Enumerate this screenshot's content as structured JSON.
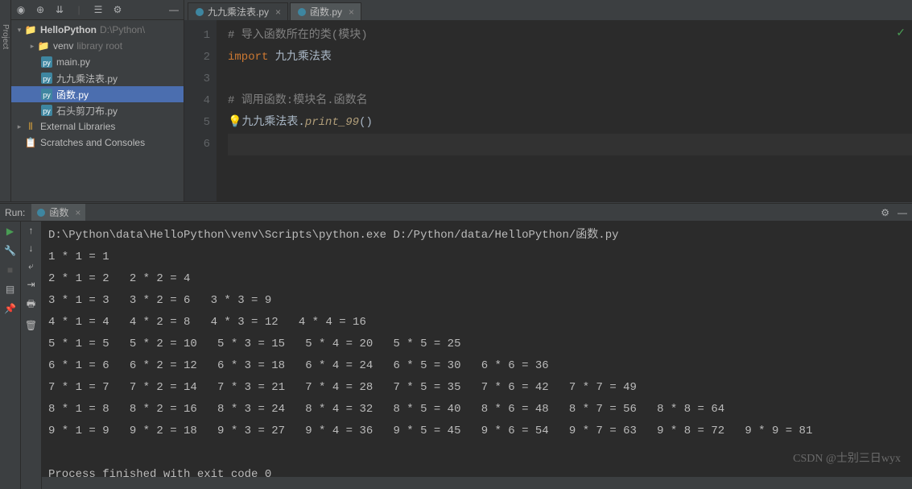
{
  "tabs": [
    {
      "label": "九九乘法表.py",
      "active": false
    },
    {
      "label": "函数.py",
      "active": true
    }
  ],
  "tree": {
    "project": "HelloPython",
    "project_path": "D:\\Python\\",
    "venv": "venv",
    "venv_tag": "library root",
    "files": [
      "main.py",
      "九九乘法表.py",
      "函数.py",
      "石头剪刀布.py"
    ],
    "selected": "函数.py",
    "ext_lib": "External Libraries",
    "scratches": "Scratches and Consoles"
  },
  "gutter": [
    "1",
    "2",
    "3",
    "4",
    "5",
    "6"
  ],
  "code": {
    "c1": "#  导入函数所在的类(模块)",
    "kw": "import",
    "imp": " 九九乘法表",
    "c2": "#  调用函数:模块名.函数名",
    "mod": "九九乘法表.",
    "fn": "print_99",
    "paren": "()"
  },
  "run": {
    "label": "Run:",
    "tab": "函数",
    "cmd": "D:\\Python\\data\\HelloPython\\venv\\Scripts\\python.exe D:/Python/data/HelloPython/函数.py",
    "lines": [
      "1 * 1 = 1",
      "2 * 1 = 2   2 * 2 = 4",
      "3 * 1 = 3   3 * 2 = 6   3 * 3 = 9",
      "4 * 1 = 4   4 * 2 = 8   4 * 3 = 12   4 * 4 = 16",
      "5 * 1 = 5   5 * 2 = 10   5 * 3 = 15   5 * 4 = 20   5 * 5 = 25",
      "6 * 1 = 6   6 * 2 = 12   6 * 3 = 18   6 * 4 = 24   6 * 5 = 30   6 * 6 = 36",
      "7 * 1 = 7   7 * 2 = 14   7 * 3 = 21   7 * 4 = 28   7 * 5 = 35   7 * 6 = 42   7 * 7 = 49",
      "8 * 1 = 8   8 * 2 = 16   8 * 3 = 24   8 * 4 = 32   8 * 5 = 40   8 * 6 = 48   8 * 7 = 56   8 * 8 = 64",
      "9 * 1 = 9   9 * 2 = 18   9 * 3 = 27   9 * 4 = 36   9 * 5 = 45   9 * 6 = 54   9 * 7 = 63   9 * 8 = 72   9 * 9 = 81"
    ],
    "exit": "Process finished with exit code 0"
  },
  "watermark": "CSDN @士别三日wyx"
}
